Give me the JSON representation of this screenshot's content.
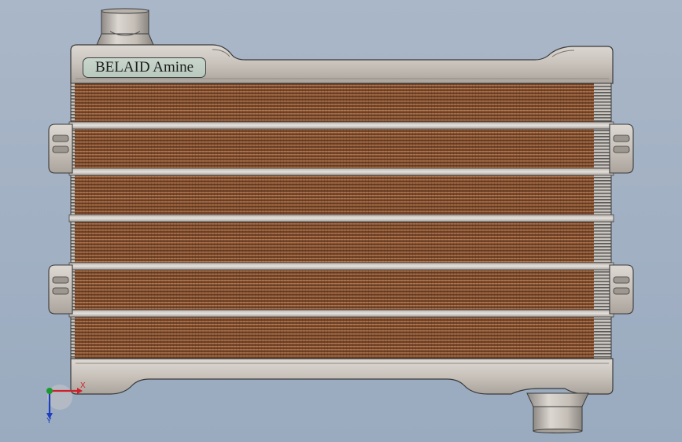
{
  "viewport": {
    "background_top": "#a9b7c8",
    "background_bottom": "#9aabbf"
  },
  "model": {
    "nameplate_text": "BELAID Amine",
    "frame_color": "#c9c3bc",
    "frame_edge_color": "#3a3a3a",
    "core_color": "#7a4a2c",
    "core_stripe_color": "#a36b47",
    "tube_count": 6,
    "mount_brackets": [
      "left-upper",
      "left-lower",
      "right-upper",
      "right-lower"
    ],
    "pipes": [
      "inlet-top",
      "outlet-bottom"
    ]
  },
  "triad": {
    "x_label": "X",
    "y_label": "Y",
    "x_color": "#d0202a",
    "y_color": "#1d3fbf",
    "z_color": "#1a9a2c"
  }
}
